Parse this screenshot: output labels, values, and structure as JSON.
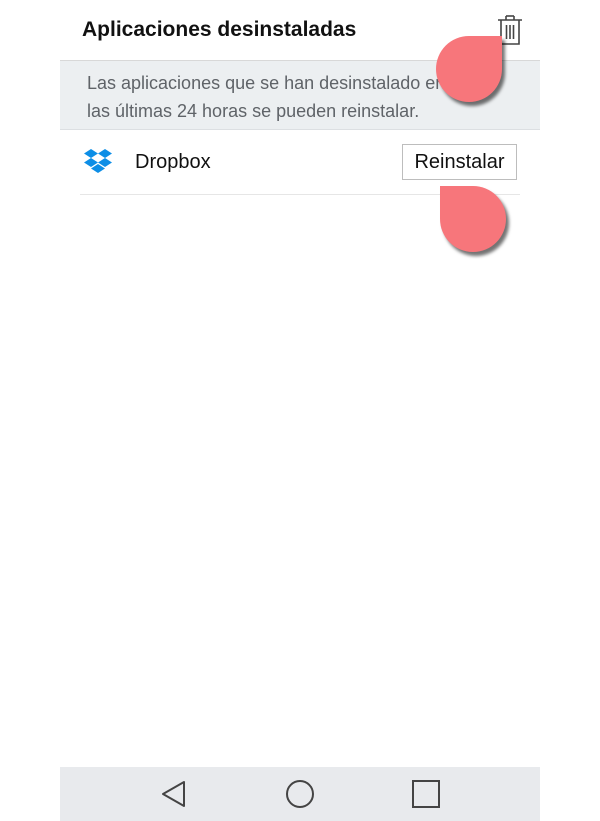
{
  "header": {
    "title": "Aplicaciones desinstaladas",
    "delete_icon": "trash-icon"
  },
  "info": {
    "line1": "Las aplicaciones que se han desinstalado en",
    "line2": "las últimas 24 horas se pueden reinstalar."
  },
  "apps": [
    {
      "name": "Dropbox",
      "icon": "dropbox-icon",
      "action_label": "Reinstalar"
    }
  ],
  "nav": {
    "back_icon": "back-triangle-icon",
    "home_icon": "home-circle-icon",
    "recents_icon": "recents-square-icon"
  },
  "colors": {
    "touch_marker": "#f7767b",
    "banner_bg": "#eceff1",
    "nav_bg": "#e8eaed",
    "dropbox_blue": "#0d8ee6"
  }
}
